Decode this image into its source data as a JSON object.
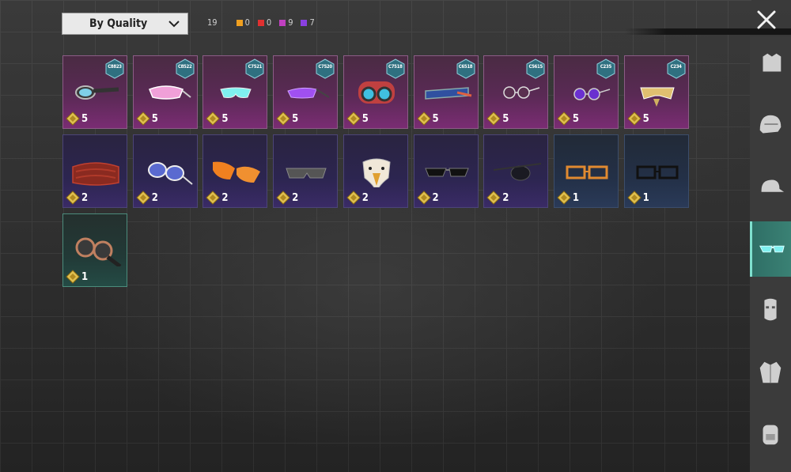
{
  "sort": {
    "label": "By Quality"
  },
  "counts": {
    "total": "19",
    "tiers": [
      {
        "value": "0",
        "color": "#f0a020"
      },
      {
        "value": "0",
        "color": "#e03030"
      },
      {
        "value": "9",
        "color": "#c040c0"
      },
      {
        "value": "7",
        "color": "#8a40e0"
      }
    ]
  },
  "items": [
    {
      "tier": "pink",
      "code": "C8823",
      "qty": "5",
      "icon": "aviator-goggles-icon"
    },
    {
      "tier": "pink",
      "code": "C8522",
      "qty": "5",
      "icon": "pink-shield-glasses-icon"
    },
    {
      "tier": "pink",
      "code": "C7521",
      "qty": "5",
      "icon": "cyan-sport-glasses-icon"
    },
    {
      "tier": "pink",
      "code": "C7520",
      "qty": "5",
      "icon": "purple-sport-glasses-icon"
    },
    {
      "tier": "pink",
      "code": "C7518",
      "qty": "5",
      "icon": "mech-goggles-icon"
    },
    {
      "tier": "pink",
      "code": "C6518",
      "qty": "5",
      "icon": "visor-glasses-icon"
    },
    {
      "tier": "pink",
      "code": "C5615",
      "qty": "5",
      "icon": "round-sunglasses-icon"
    },
    {
      "tier": "pink",
      "code": "C235",
      "qty": "5",
      "icon": "purple-round-glasses-icon"
    },
    {
      "tier": "pink",
      "code": "C234",
      "qty": "5",
      "icon": "gold-mask-glasses-icon"
    },
    {
      "tier": "purple",
      "code": "",
      "qty": "2",
      "icon": "red-bandana-icon"
    },
    {
      "tier": "purple",
      "code": "",
      "qty": "2",
      "icon": "heart-glasses-icon"
    },
    {
      "tier": "purple",
      "code": "",
      "qty": "2",
      "icon": "orange-glasses-icon"
    },
    {
      "tier": "purple",
      "code": "",
      "qty": "2",
      "icon": "dark-shades-icon"
    },
    {
      "tier": "purple",
      "code": "",
      "qty": "2",
      "icon": "eagle-mask-icon"
    },
    {
      "tier": "purple",
      "code": "",
      "qty": "2",
      "icon": "black-sunglasses-icon"
    },
    {
      "tier": "purple",
      "code": "",
      "qty": "2",
      "icon": "eyepatch-icon"
    },
    {
      "tier": "blue",
      "code": "",
      "qty": "1",
      "icon": "orange-rect-glasses-icon"
    },
    {
      "tier": "blue",
      "code": "",
      "qty": "1",
      "icon": "black-rect-glasses-icon"
    },
    {
      "tier": "green",
      "code": "",
      "qty": "1",
      "icon": "steampunk-goggles-icon"
    }
  ],
  "sidebar": [
    {
      "icon": "outfit-icon",
      "active": false
    },
    {
      "icon": "helmet-icon",
      "active": false
    },
    {
      "icon": "cap-icon",
      "active": false
    },
    {
      "icon": "glasses-icon",
      "active": true
    },
    {
      "icon": "mask-icon",
      "active": false
    },
    {
      "icon": "jacket-icon",
      "active": false
    },
    {
      "icon": "backpack-icon",
      "active": false
    }
  ]
}
